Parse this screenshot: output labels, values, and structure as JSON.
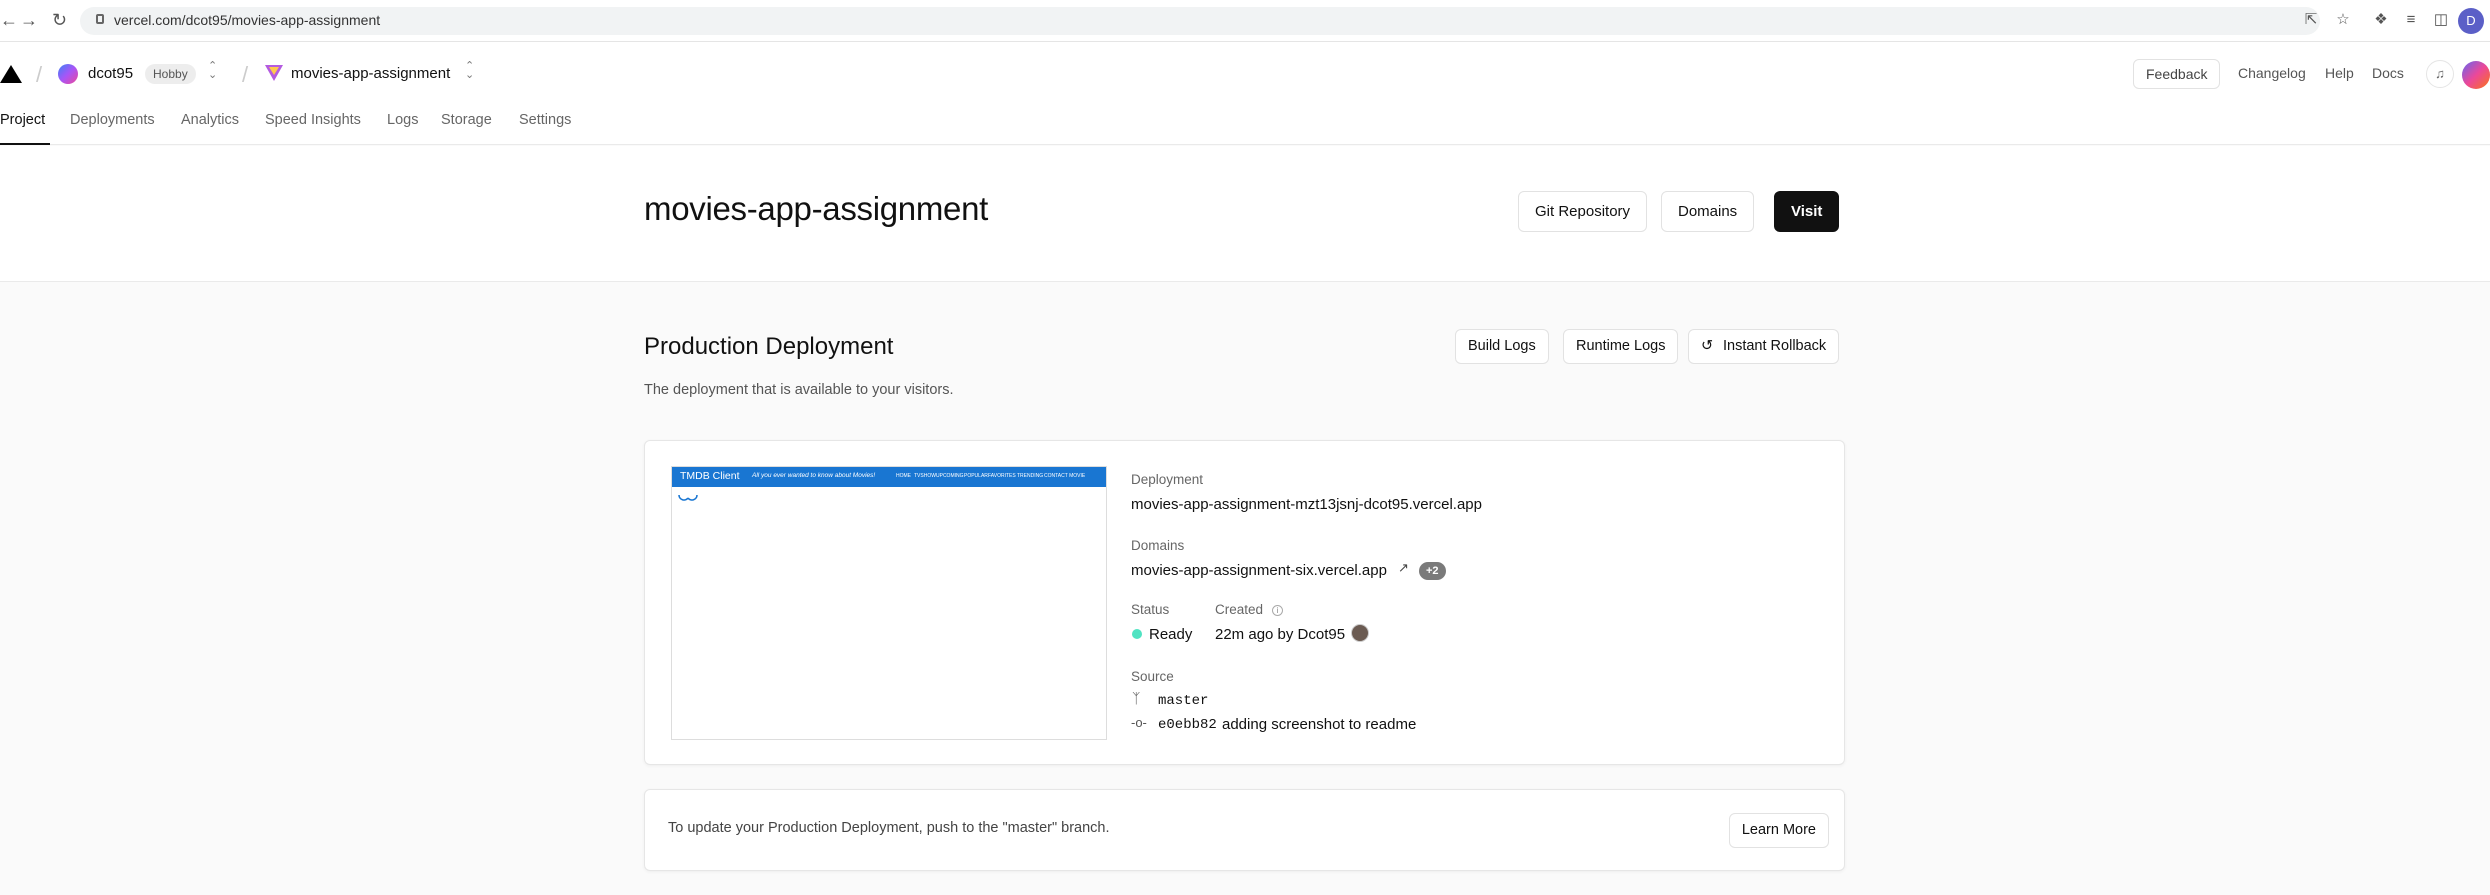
{
  "browser": {
    "url": "vercel.com/dcot95/movies-app-assignment",
    "profile_initial": "D"
  },
  "header": {
    "team": {
      "name": "dcot95",
      "plan": "Hobby"
    },
    "project": {
      "name": "movies-app-assignment"
    },
    "feedback_label": "Feedback",
    "links": [
      "Changelog",
      "Help",
      "Docs"
    ]
  },
  "tabs": [
    "Project",
    "Deployments",
    "Analytics",
    "Speed Insights",
    "Logs",
    "Storage",
    "Settings"
  ],
  "active_tab": "Project",
  "title_band": {
    "title": "movies-app-assignment",
    "git_repository_label": "Git Repository",
    "domains_label": "Domains",
    "visit_label": "Visit"
  },
  "production": {
    "title": "Production Deployment",
    "description": "The deployment that is available to your visitors.",
    "build_logs_label": "Build Logs",
    "runtime_logs_label": "Runtime Logs",
    "instant_rollback_label": "Instant Rollback",
    "preview": {
      "brand": "TMDB Client",
      "tagline": "All you ever wanted to know about Movies!",
      "nav": [
        "HOME",
        "TVSHOW",
        "UPCOMING",
        "POPULAR",
        "FAVORITES",
        "TRENDING",
        "CONTACT MOVIE"
      ]
    },
    "deployment_label": "Deployment",
    "deployment_url": "movies-app-assignment-mzt13jsnj-dcot95.vercel.app",
    "domains_label": "Domains",
    "domain": "movies-app-assignment-six.vercel.app",
    "domains_extra": "+2",
    "status_label": "Status",
    "status": "Ready",
    "status_color": "#50e3c2",
    "created_label": "Created",
    "created": "22m ago by Dcot95",
    "source_label": "Source",
    "branch": "master",
    "commit_hash": "e0ebb82",
    "commit_message": "adding screenshot to readme"
  },
  "footer": {
    "text": "To update your Production Deployment, push to the \"master\" branch.",
    "learn_more_label": "Learn More"
  }
}
